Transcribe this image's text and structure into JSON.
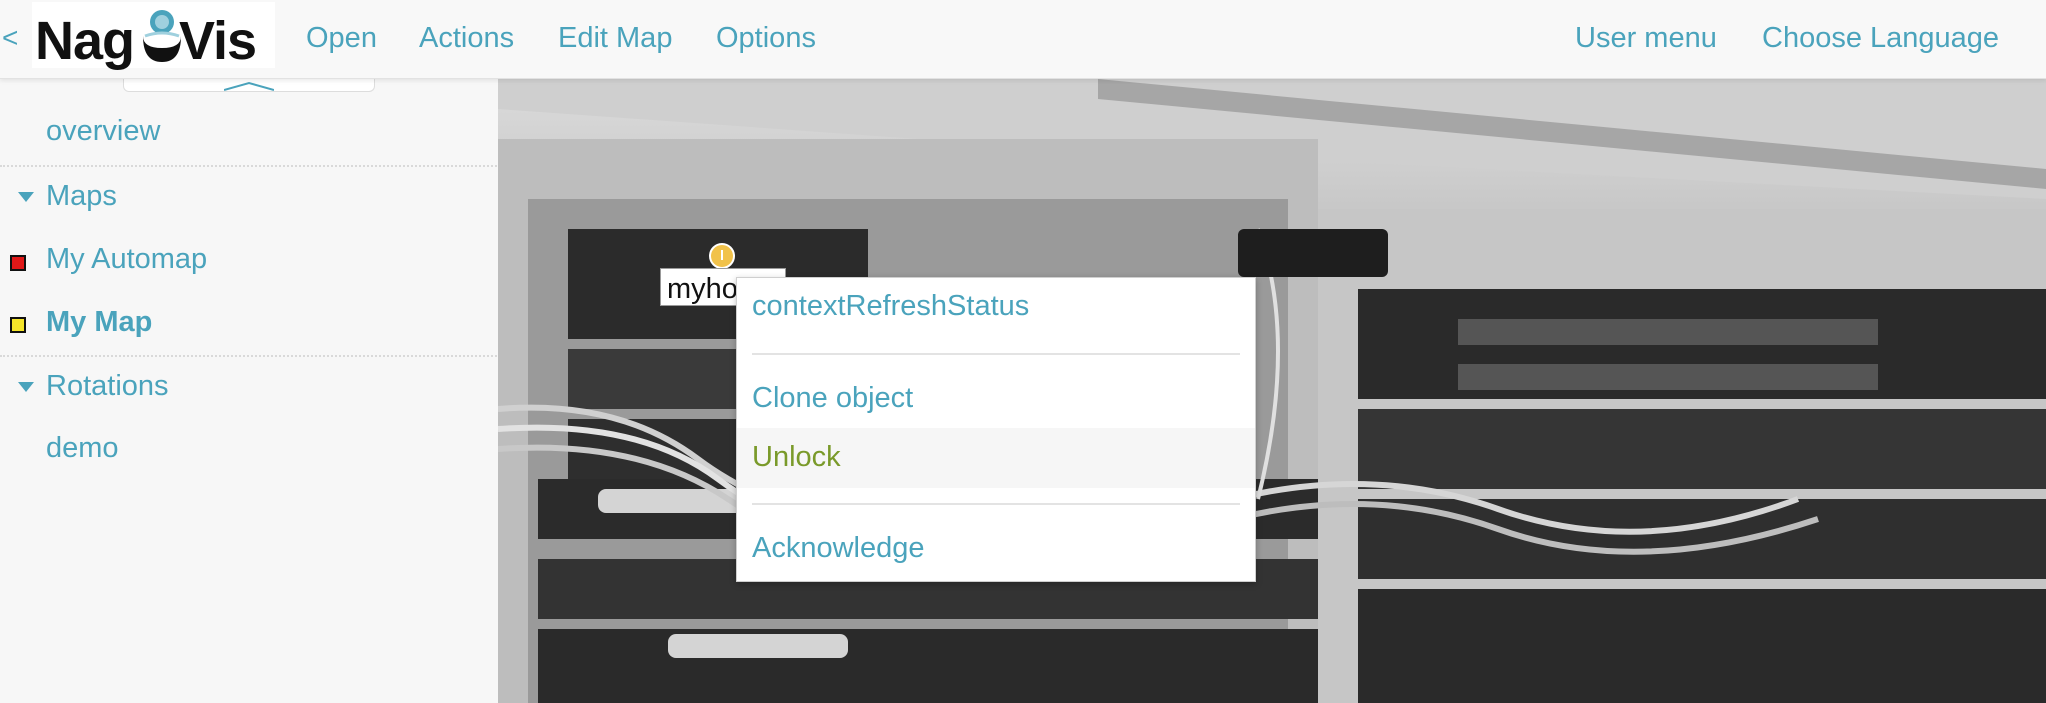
{
  "header": {
    "collapse_label": "<",
    "logo": {
      "text_left": "Nag",
      "text_right": "Vis"
    },
    "nav": [
      "Open",
      "Actions",
      "Edit Map",
      "Options"
    ],
    "right_nav": [
      "User menu",
      "Choose Language"
    ]
  },
  "sidebar": {
    "overview": "overview",
    "maps_label": "Maps",
    "maps": [
      {
        "label": "My Automap",
        "status_color": "#e01818",
        "active": false
      },
      {
        "label": "My Map",
        "status_color": "#f5e52a",
        "active": true
      }
    ],
    "rotations_label": "Rotations",
    "rotations": [
      "demo"
    ]
  },
  "map": {
    "host_label": "myho",
    "host_status_color": "#f1c24a"
  },
  "context_menu": {
    "items": [
      "contextRefreshStatus",
      "Clone object",
      "Unlock",
      "Acknowledge"
    ],
    "highlight_color": "#7a9a2a"
  },
  "colors": {
    "accent": "#4aa3bc",
    "bg": "#f7f7f7"
  }
}
